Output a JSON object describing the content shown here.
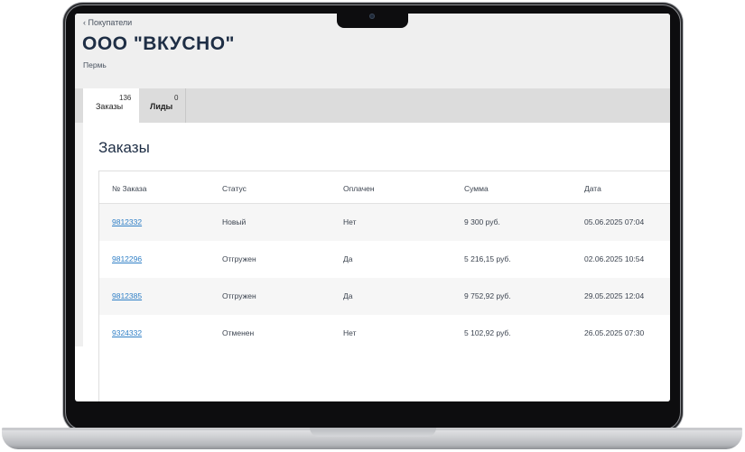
{
  "header": {
    "back_link": "‹ Покупатели",
    "title": "ООО \"ВКУСНО\"",
    "subtitle": "Пермь"
  },
  "tabs": [
    {
      "label": "Заказы",
      "count": "136",
      "active": true
    },
    {
      "label": "Лиды",
      "count": "0",
      "active": false
    }
  ],
  "section": {
    "title": "Заказы"
  },
  "table": {
    "columns": [
      "№ Заказа",
      "Статус",
      "Оплачен",
      "Сумма",
      "Дата"
    ],
    "rows": [
      {
        "order": "9812332",
        "status": "Новый",
        "paid": "Нет",
        "sum": "9 300 руб.",
        "date": "05.06.2025 07:04"
      },
      {
        "order": "9812296",
        "status": "Отгружен",
        "paid": "Да",
        "sum": "5 216,15 руб.",
        "date": "02.06.2025 10:54"
      },
      {
        "order": "9812385",
        "status": "Отгружен",
        "paid": "Да",
        "sum": "9 752,92 руб.",
        "date": "29.05.2025 12:04"
      },
      {
        "order": "9324332",
        "status": "Отменен",
        "paid": "Нет",
        "sum": "5 102,92 руб.",
        "date": "26.05.2025 07:30"
      }
    ]
  },
  "colors": {
    "link": "#2f7fc6",
    "title": "#1e2e45",
    "header_bg": "#efefef",
    "tabs_bg": "#dcdcdc"
  }
}
